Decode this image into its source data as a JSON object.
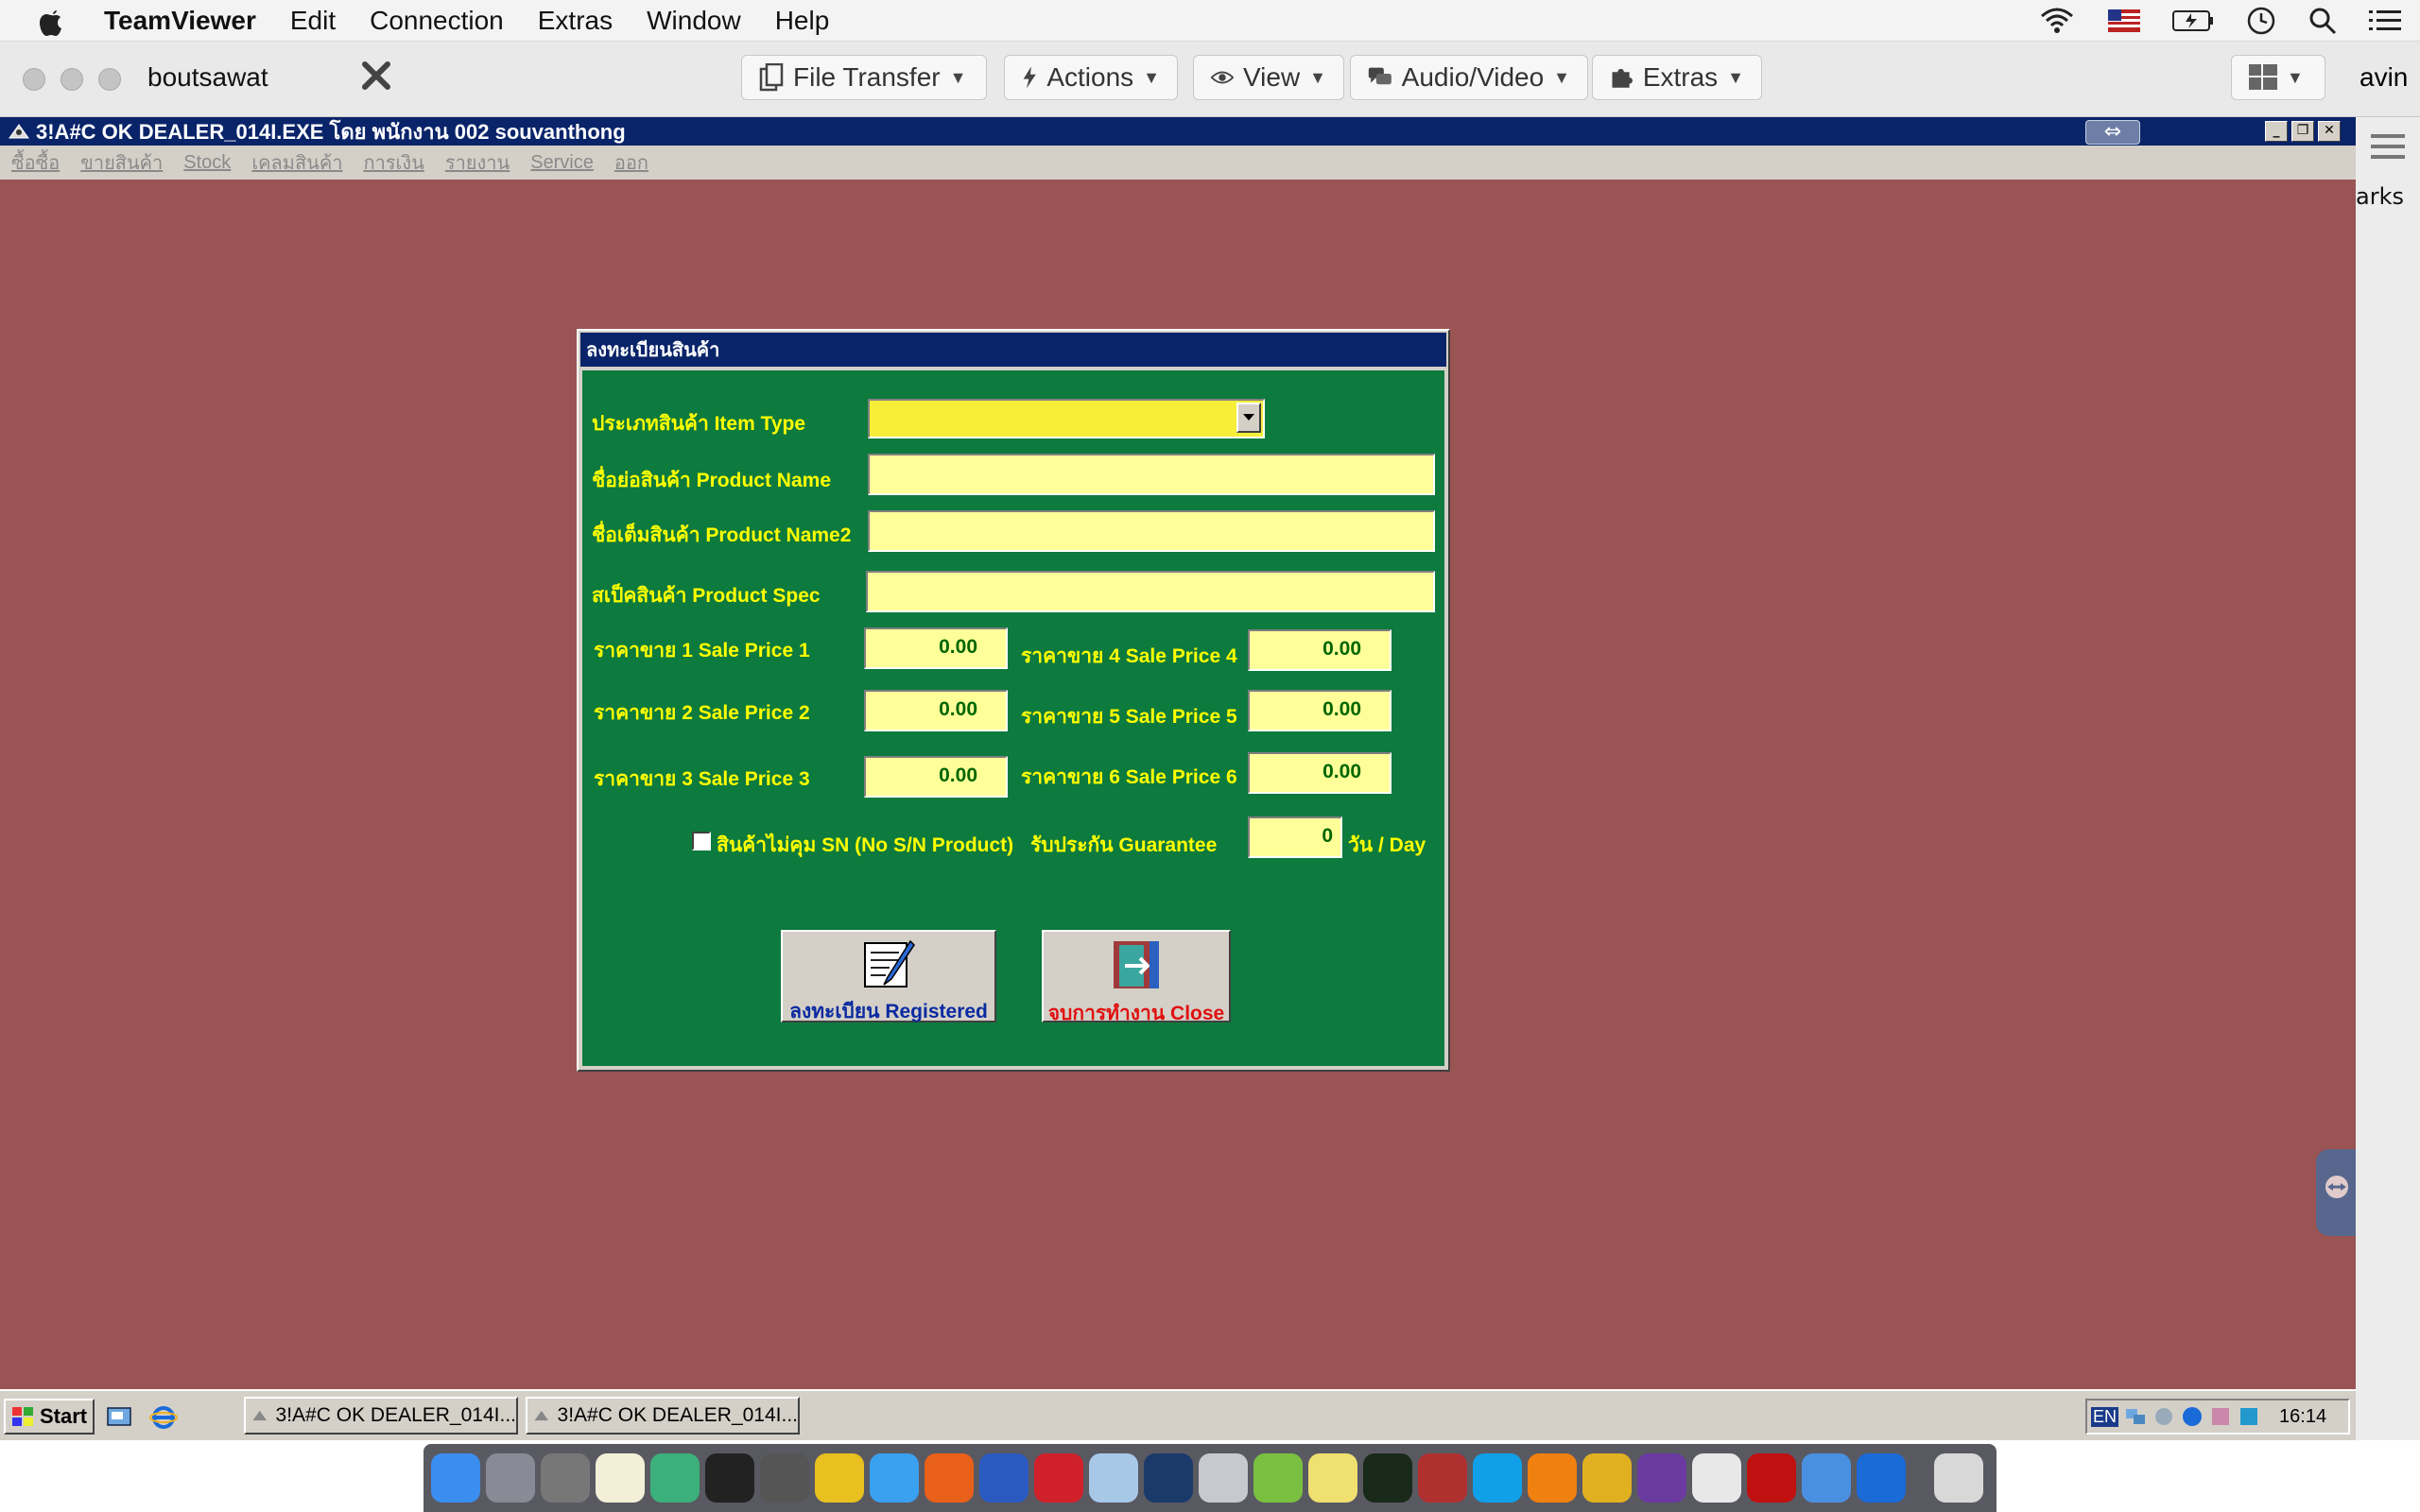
{
  "mac_menubar": {
    "app_name": "TeamViewer",
    "items": [
      "Edit",
      "Connection",
      "Extras",
      "Window",
      "Help"
    ],
    "status_icons": [
      "wifi-icon",
      "us-flag-icon",
      "battery-icon",
      "clock-icon",
      "search-icon",
      "list-icon"
    ]
  },
  "teamviewer": {
    "session_name": "boutsawat",
    "toolbar": [
      {
        "label": "File Transfer",
        "icon": "file-transfer-icon"
      },
      {
        "label": "Actions",
        "icon": "lightning-icon"
      },
      {
        "label": "View",
        "icon": "eye-icon"
      },
      {
        "label": "Audio/Video",
        "icon": "chat-bubble-icon"
      },
      {
        "label": "Extras",
        "icon": "puzzle-icon"
      }
    ],
    "right_partial_text": "avin",
    "side_partial_text": "arks"
  },
  "app": {
    "title": "3!A#C OK DEALER_014I.EXE โดย พนักงาน 002 souvanthong",
    "menu": [
      "ซื้อซื้อ",
      "ขายสินค้า",
      "Stock",
      "เคลมสินค้า",
      "การเงิน",
      "รายงาน",
      "Service",
      "ออก"
    ]
  },
  "dialog": {
    "title": "ลงทะเบียนสินค้า",
    "item_type_label": "ประเภทสินค้า Item Type",
    "product_name_label": "ชื่อย่อสินค้า Product Name",
    "product_name2_label": "ชื่อเต็มสินค้า Product Name2",
    "product_spec_label": "สเป็คสินค้า Product Spec",
    "prices": [
      {
        "label": "ราคาขาย 1 Sale Price 1",
        "value": "0.00"
      },
      {
        "label": "ราคาขาย 2 Sale Price 2",
        "value": "0.00"
      },
      {
        "label": "ราคาขาย 3 Sale Price 3",
        "value": "0.00"
      },
      {
        "label": "ราคาขาย 4 Sale Price 4",
        "value": "0.00"
      },
      {
        "label": "ราคาขาย 5 Sale Price 5",
        "value": "0.00"
      },
      {
        "label": "ราคาขาย 6 Sale Price 6",
        "value": "0.00"
      }
    ],
    "no_sn_label": "สินค้าไม่คุม SN (No S/N Product)",
    "guarantee_label": "รับประกัน Guarantee",
    "guarantee_value": "0",
    "guarantee_unit": "วัน / Day",
    "register_button": "ลงทะเบียน Registered",
    "close_button": "จบการทำงาน Close",
    "colors": {
      "body": "#0d7a3e",
      "label": "#ffff00",
      "field": "#ffff99"
    }
  },
  "taskbar": {
    "start": "Start",
    "tasks": [
      "3!A#C OK DEALER_014I...",
      "3!A#C OK DEALER_014I..."
    ],
    "lang": "EN",
    "clock": "16:14"
  }
}
